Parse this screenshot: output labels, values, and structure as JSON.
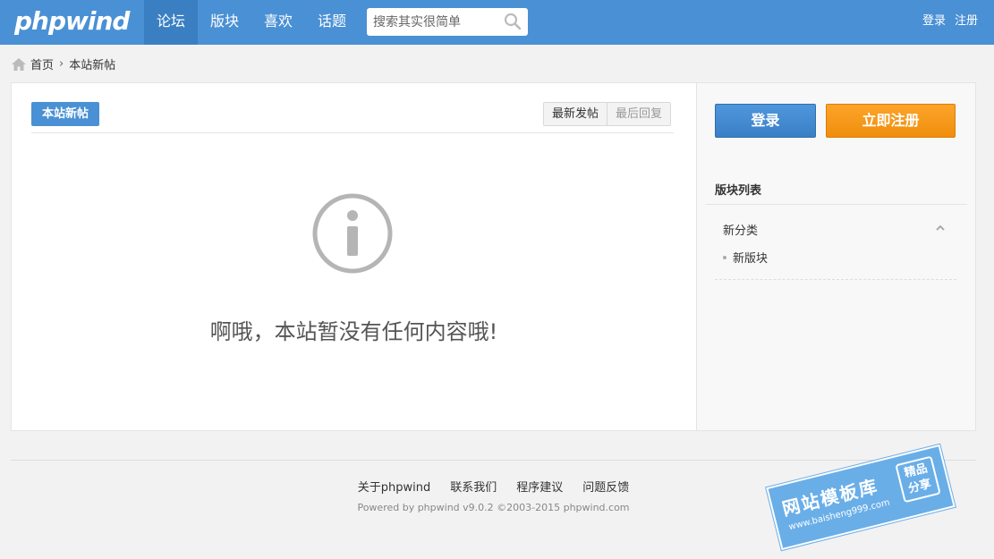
{
  "header": {
    "logo": "phpwind",
    "nav": [
      "论坛",
      "版块",
      "喜欢",
      "话题"
    ],
    "search_placeholder": "搜索其实很简单",
    "login": "登录",
    "register": "注册"
  },
  "breadcrumb": {
    "home": "首页",
    "current": "本站新帖"
  },
  "main": {
    "tag": "本站新帖",
    "tabs": [
      "最新发帖",
      "最后回复"
    ],
    "empty_message": "啊哦，本站暂没有任何内容哦!"
  },
  "sidebar": {
    "login_button": "登录",
    "register_button": "立即注册",
    "forum_list_title": "版块列表",
    "category": "新分类",
    "forum": "新版块"
  },
  "footer": {
    "links": [
      "关于phpwind",
      "联系我们",
      "程序建议",
      "问题反馈"
    ],
    "copyright": "Powered by phpwind v9.0.2 ©2003-2015 phpwind.com"
  },
  "watermark": {
    "title": "网站模板库",
    "url": "www.baisheng999.com",
    "badge_line1": "精品",
    "badge_line2": "分享"
  },
  "colors": {
    "header": "#4a90d4",
    "active_nav": "#3a7fc2",
    "login_button": "#3a7fc6",
    "register_button": "#f08e0d"
  }
}
